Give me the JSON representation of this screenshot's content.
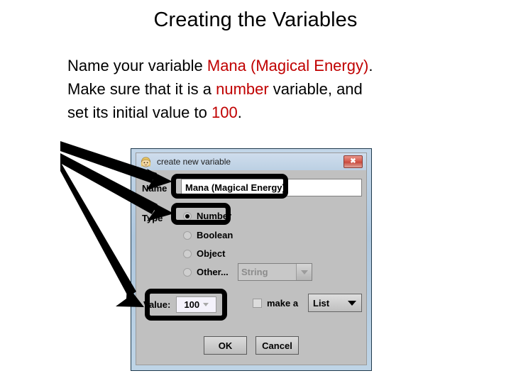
{
  "slide": {
    "title": "Creating the Variables",
    "body": {
      "line1_pre": "Name your variable ",
      "line1_hl": "Mana (Magical Energy)",
      "line1_post": ".",
      "line2_pre": "Make sure that it is a ",
      "line2_hl": "number",
      "line2_post": " variable, and",
      "line3_pre": "set its initial value to ",
      "line3_hl": "100",
      "line3_post": "."
    },
    "highlight_color": "#c00000"
  },
  "dialog": {
    "titlebar": {
      "icon": "alice-character-icon",
      "title": "create new variable",
      "close_label": "✖",
      "close_color": "#c8483c"
    },
    "name_field": {
      "label": "Name",
      "value": "Mana (Magical Energy)"
    },
    "type_field": {
      "label": "Type",
      "options": [
        {
          "label": "Number",
          "selected": true
        },
        {
          "label": "Boolean",
          "selected": false
        },
        {
          "label": "Object",
          "selected": false
        },
        {
          "label": "Other...",
          "selected": false
        }
      ],
      "other_combo_value": "String"
    },
    "value_field": {
      "label": "Value:",
      "value": "100"
    },
    "make_a": {
      "checkbox_label": "make a",
      "checked": false,
      "list_combo_value": "List"
    },
    "buttons": {
      "ok": "OK",
      "cancel": "Cancel"
    }
  },
  "annotations": {
    "boxes": [
      {
        "name": "name-field-highlight"
      },
      {
        "name": "number-radio-highlight"
      },
      {
        "name": "value-field-highlight"
      }
    ],
    "arrow_count": 3,
    "color": "#000000"
  }
}
